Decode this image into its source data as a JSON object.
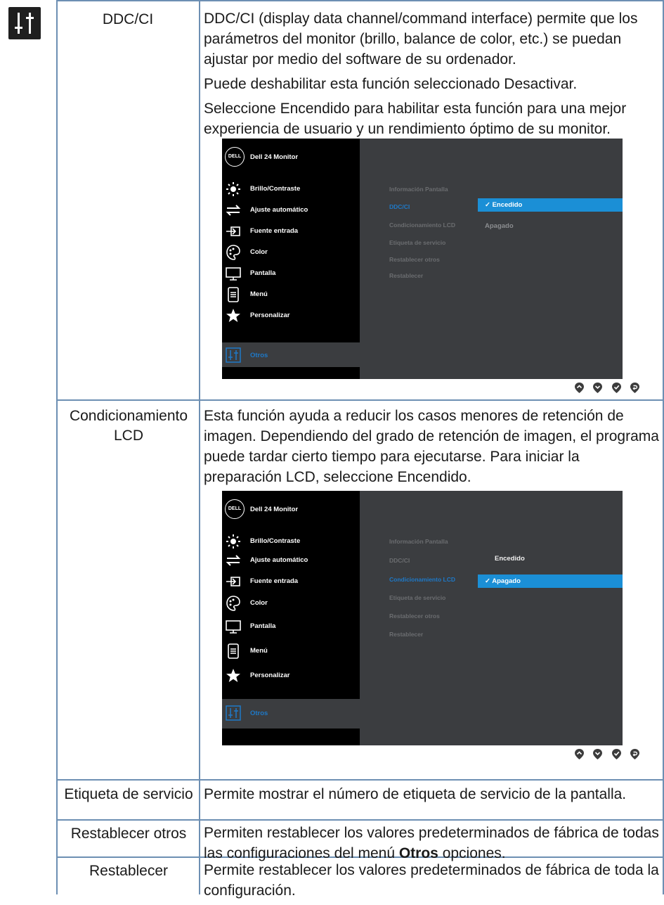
{
  "rows": [
    {
      "name": "DDC/CI",
      "paragraphs": [
        "DDC/CI (display data channel/command interface) permite que los parámetros del monitor (brillo, balance de color, etc.) se puedan ajustar por medio del software de su ordenador.",
        "Puede deshabilitar esta función seleccionado Desactivar.",
        "Seleccione Encendido para habilitar esta función para una mejor experiencia de usuario y un rendimiento óptimo de su monitor."
      ]
    },
    {
      "name": "Condicionamiento LCD",
      "paragraphs": [
        "Esta función ayuda a reducir los casos menores de retención de imagen. Dependiendo del grado de retención de imagen, el programa puede tardar cierto tiempo para ejecutarse. Para iniciar la preparación LCD, seleccione Encendido."
      ]
    },
    {
      "name": "Etiqueta de servicio",
      "paragraphs": [
        "Permite mostrar el número de etiqueta de servicio de la pantalla."
      ]
    },
    {
      "name": "Restablecer otros",
      "paragraph_before": "Permiten restablecer los valores predeterminados de fábrica de todas las configuraciones del menú ",
      "paragraph_bold": "Otros",
      "paragraph_after": " opciones."
    },
    {
      "name": "Restablecer",
      "paragraphs": [
        "Permite restablecer los valores predeterminados de fábrica de toda la configuración."
      ]
    }
  ],
  "osd": {
    "logo": "DELL",
    "title": "Dell 24 Monitor",
    "menu": [
      "Brillo/Contraste",
      "Ajuste automático",
      "Fuente entrada",
      "Color",
      "Pantalla",
      "Menú",
      "Personalizar",
      "Otros"
    ],
    "menu_icons": [
      "brightness-icon",
      "auto-adjust-icon",
      "input-source-icon",
      "color-icon",
      "display-icon",
      "menu-icon",
      "star-icon",
      "others-icon"
    ],
    "submenu": [
      "Información Pantalla",
      "DDC/CI",
      "Condicionamiento LCD",
      "Etiqueta de servicio",
      "Restablecer otros",
      "Restablecer"
    ],
    "screen1": {
      "opt1": "✓ Encedido",
      "opt2": "Apagado"
    },
    "screen2": {
      "opt1": "Encedido",
      "opt2": "✓ Apagado"
    },
    "nav_icons": [
      "up-icon",
      "down-icon",
      "check-icon",
      "back-icon"
    ]
  },
  "colors": {
    "grid": "#6d8fb3",
    "osd_bg": "#3b3d40",
    "highlight": "#1e79c8",
    "selected_bar": "#1b8fd6"
  }
}
